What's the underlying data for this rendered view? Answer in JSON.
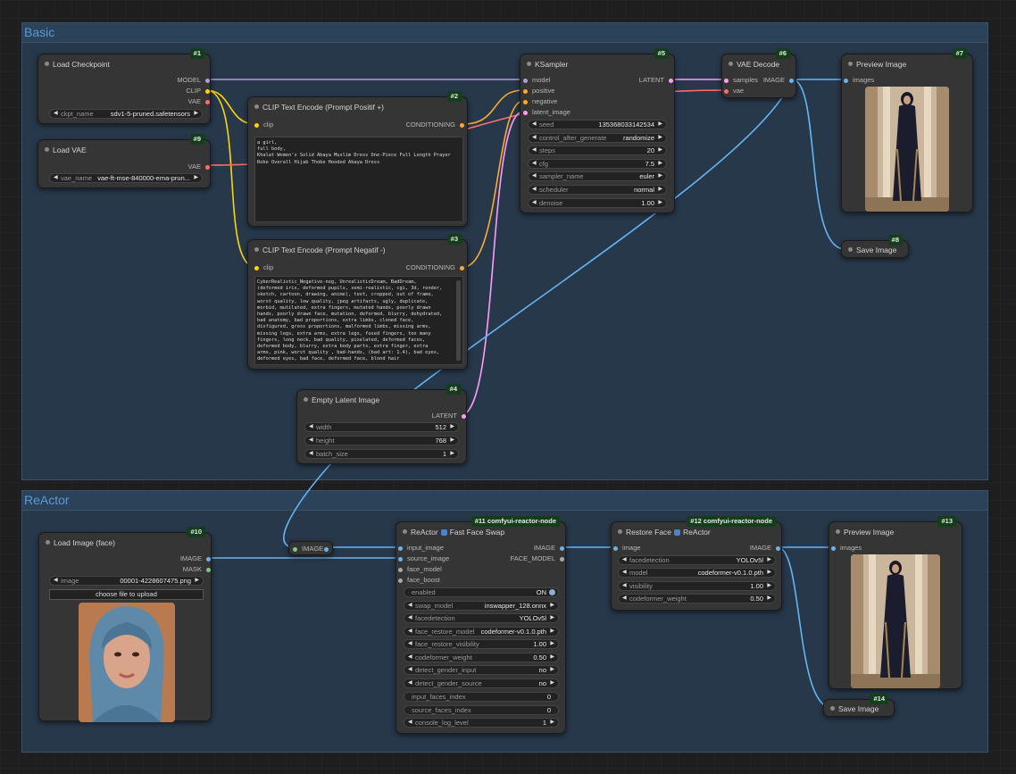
{
  "groups": {
    "basic": "Basic",
    "reactor": "ReActor"
  },
  "colors": {
    "model": "#b39ddb",
    "clip": "#ffd500",
    "vae": "#ff6e6e",
    "conditioning": "#ffa931",
    "latent": "#ff9cf9",
    "image": "#64b5f6",
    "mask": "#81c784",
    "face": "#aaaaaa"
  },
  "nodes": {
    "load_checkpoint": {
      "id": "#1",
      "title": "Load Checkpoint",
      "out_model": "MODEL",
      "out_clip": "CLIP",
      "out_vae": "VAE",
      "w_label": "ckpt_name",
      "w_value": "sdv1-5-pruned.safetensors"
    },
    "load_vae": {
      "id": "#9",
      "title": "Load VAE",
      "out_vae": "VAE",
      "w_label": "vae_name",
      "w_value": "vae-ft-mse-840000-ema-prun..."
    },
    "clip_pos": {
      "id": "#2",
      "title": "CLIP Text Encode (Prompt Positif +)",
      "in_clip": "clip",
      "out": "CONDITIONING",
      "text": "a girl,\nfull body,\nKhalat Women's Solid Abaya Muslim Dress One-Piece Full Length Prayer\nRobe Overall Hijab Thobe Hooded Abaya Dress"
    },
    "clip_neg": {
      "id": "#3",
      "title": "CLIP Text Encode (Prompt Negatif -)",
      "in_clip": "clip",
      "out": "CONDITIONING",
      "text": "CyberRealistic_Negative-neg, UnrealisticDream, BadDream,\n(deformed iris, deformed pupils, semi-realistic, cgi, 3d, render,\nsketch, cartoon, drawing, anime), text, cropped, out of frame,\nworst quality, low quality, jpeg artifacts, ugly, duplicate,\nmorbid, mutilated, extra fingers, mutated hands, poorly drawn\nhands, poorly drawn face, mutation, deformed, blurry, dehydrated,\nbad anatomy, bad proportions, extra limbs, cloned face,\ndisfigured, gross proportions, malformed limbs, missing arms,\nmissing legs, extra arms, extra legs, fused fingers, too many\nfingers, long neck, bad quality, pixelated, deformed faces,\ndeformed body, blurry, extra body parts, extra finger, extra\narms, pink, worst quality , bad-hands, (bad art: 1.4), bad eyes,\ndeformed eyes, bad face, deformed face, blond hair"
    },
    "ksampler": {
      "id": "#5",
      "title": "KSampler",
      "inputs": [
        "model",
        "positive",
        "negative",
        "latent_image"
      ],
      "out": "LATENT",
      "widgets": [
        {
          "label": "seed",
          "value": "135368033142534"
        },
        {
          "label": "control_after_generate",
          "value": "randomize"
        },
        {
          "label": "steps",
          "value": "20"
        },
        {
          "label": "cfg",
          "value": "7.5"
        },
        {
          "label": "sampler_name",
          "value": "euler"
        },
        {
          "label": "scheduler",
          "value": "normal"
        },
        {
          "label": "denoise",
          "value": "1.00"
        }
      ]
    },
    "vae_decode": {
      "id": "#6",
      "title": "VAE Decode",
      "in_samples": "samples",
      "in_vae": "vae",
      "out": "IMAGE"
    },
    "preview1": {
      "id": "#7",
      "title": "Preview Image",
      "in": "images"
    },
    "save1": {
      "id": "#8",
      "title": "Save Image"
    },
    "empty_latent": {
      "id": "#4",
      "title": "Empty Latent Image",
      "out": "LATENT",
      "widgets": [
        {
          "label": "width",
          "value": "512"
        },
        {
          "label": "height",
          "value": "768"
        },
        {
          "label": "batch_size",
          "value": "1"
        }
      ]
    },
    "load_image": {
      "id": "#10",
      "title": "Load Image (face)",
      "out_image": "IMAGE",
      "out_mask": "MASK",
      "w_label": "image",
      "w_value": "00001-4228607475.png",
      "upload": "choose file to upload"
    },
    "reroute": {
      "label": "IMAGE"
    },
    "reactor": {
      "id": "#11 comfyui-reactor-node",
      "title_a": "ReActor",
      "title_b": "Fast Face Swap",
      "inputs": [
        "input_image",
        "source_image",
        "face_model",
        "face_boost"
      ],
      "out_image": "IMAGE",
      "out_face": "FACE_MODEL",
      "enabled_label": "enabled",
      "enabled_value": "ON",
      "widgets": [
        {
          "label": "swap_model",
          "value": "inswapper_128.onnx"
        },
        {
          "label": "facedetection",
          "value": "YOLOv5l"
        },
        {
          "label": "face_restore_model",
          "value": "codeformer-v0.1.0.pth"
        },
        {
          "label": "face_restore_visibility",
          "value": "1.00"
        },
        {
          "label": "codeformer_weight",
          "value": "0.50"
        },
        {
          "label": "detect_gender_input",
          "value": "no"
        },
        {
          "label": "detect_gender_source",
          "value": "no"
        }
      ],
      "plain": [
        {
          "label": "input_faces_index",
          "value": "0"
        },
        {
          "label": "source_faces_index",
          "value": "0"
        }
      ],
      "console": {
        "label": "console_log_level",
        "value": "1"
      }
    },
    "restore": {
      "id": "#12 comfyui-reactor-node",
      "title_a": "Restore Face",
      "title_b": "ReActor",
      "in": "image",
      "out": "IMAGE",
      "widgets": [
        {
          "label": "facedetection",
          "value": "YOLOv5l"
        },
        {
          "label": "model",
          "value": "codeformer-v0.1.0.pth"
        },
        {
          "label": "visibility",
          "value": "1.00"
        },
        {
          "label": "codeformer_weight",
          "value": "0.50"
        }
      ]
    },
    "preview2": {
      "id": "#13",
      "title": "Preview Image",
      "in": "images"
    },
    "save2": {
      "id": "#14",
      "title": "Save Image"
    }
  }
}
